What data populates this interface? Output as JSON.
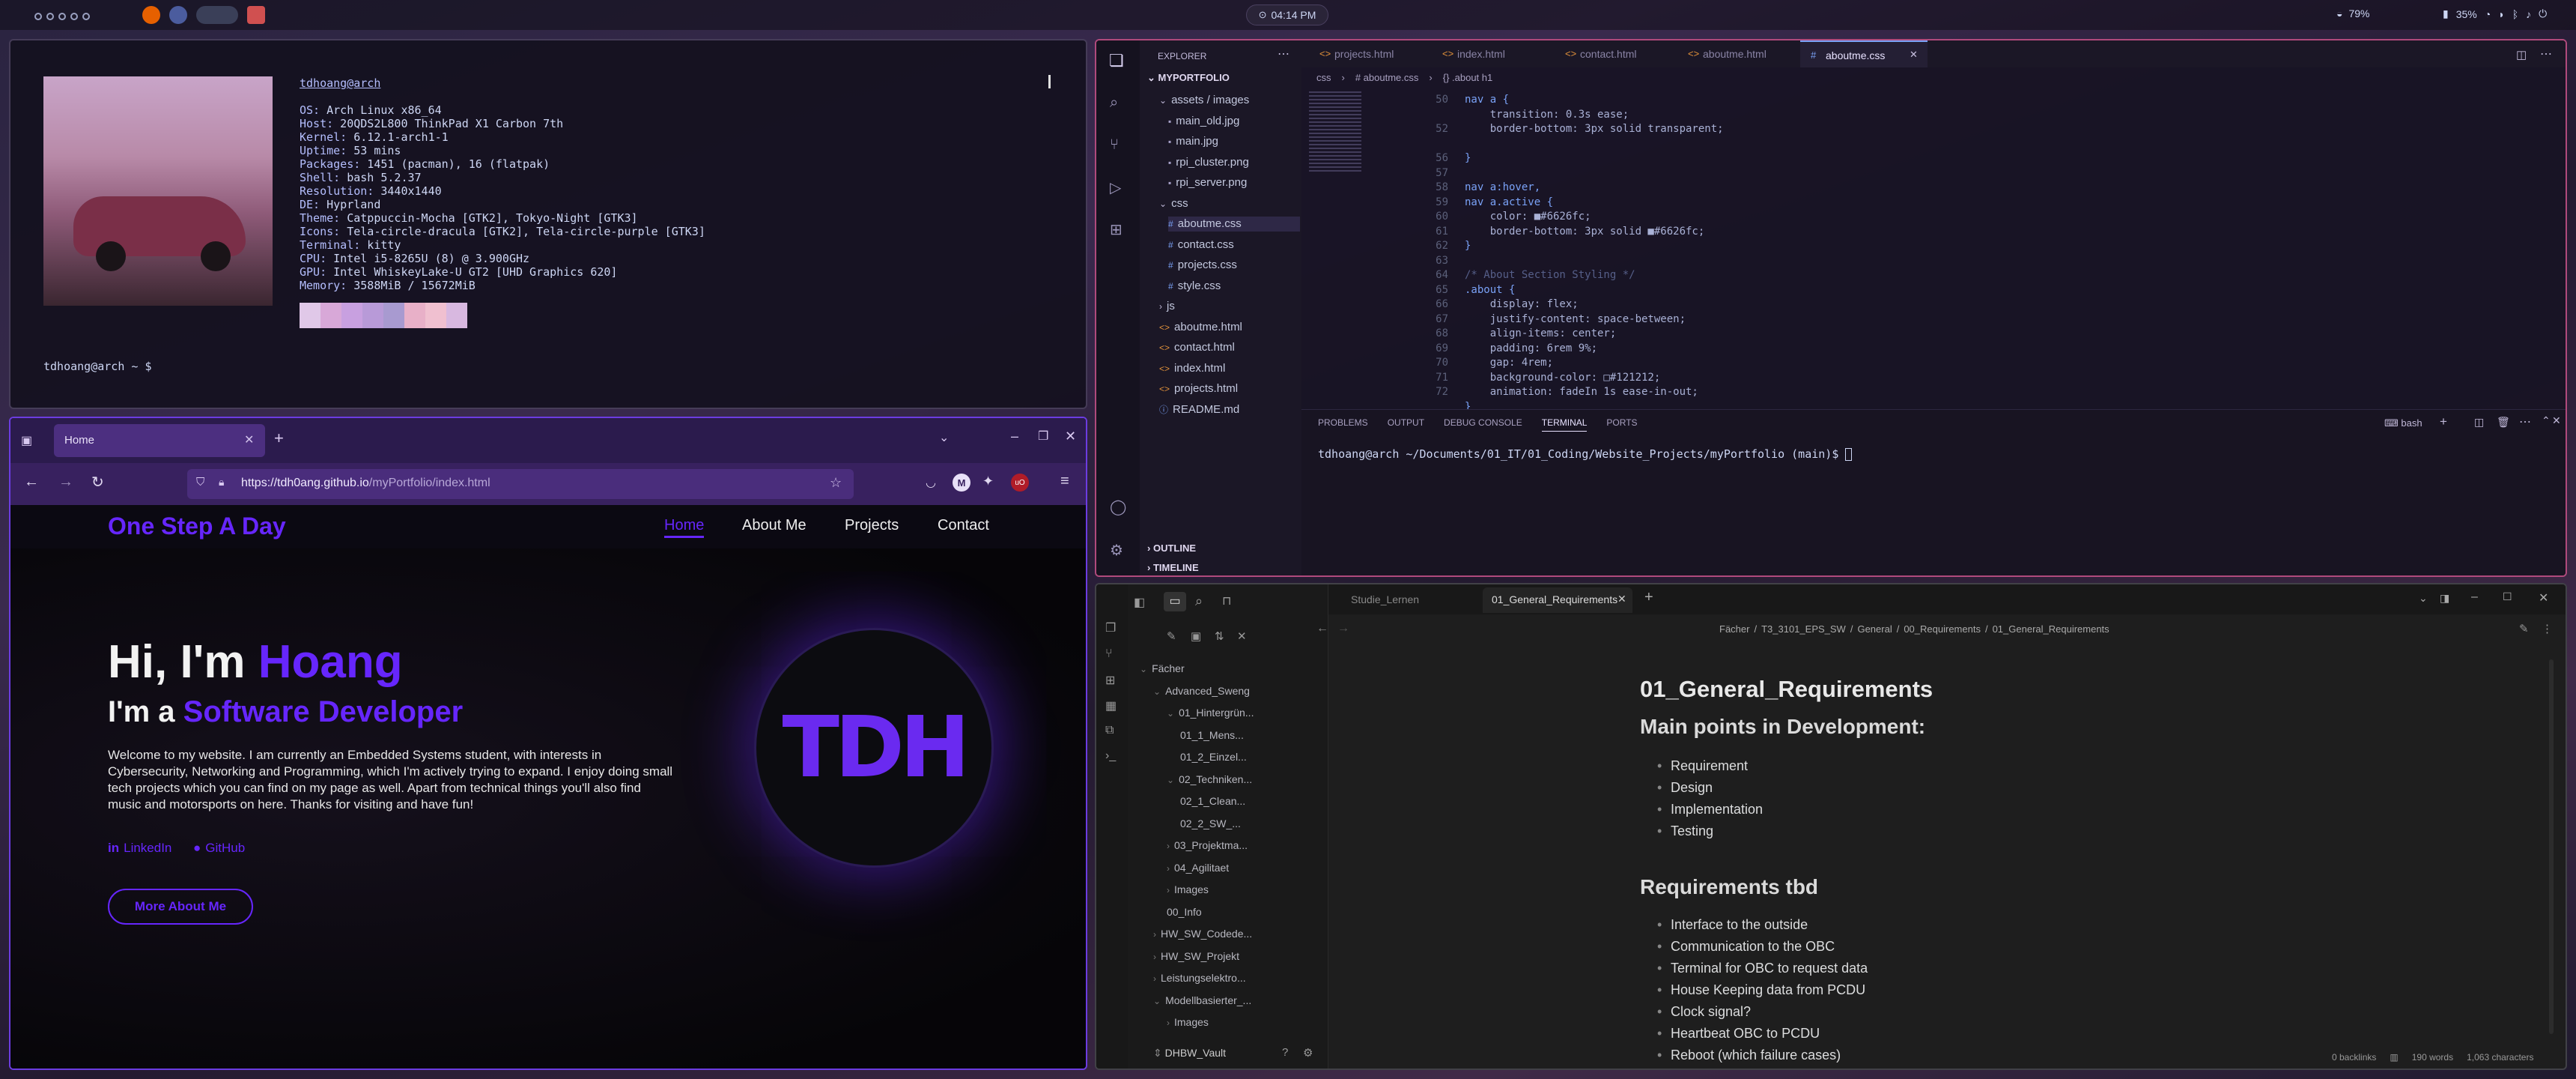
{
  "topbar": {
    "clock": "04:14 PM",
    "wifi_percent": "79%",
    "battery_percent": "35%"
  },
  "terminal": {
    "user_host": "tdhoang@arch",
    "info": [
      {
        "k": "OS:",
        "v": " Arch Linux x86_64"
      },
      {
        "k": "Host:",
        "v": " 20QDS2L800 ThinkPad X1 Carbon 7th"
      },
      {
        "k": "Kernel:",
        "v": " 6.12.1-arch1-1"
      },
      {
        "k": "Uptime:",
        "v": " 53 mins"
      },
      {
        "k": "Packages:",
        "v": " 1451 (pacman), 16 (flatpak)"
      },
      {
        "k": "Shell:",
        "v": " bash 5.2.37"
      },
      {
        "k": "Resolution:",
        "v": " 3440x1440"
      },
      {
        "k": "DE:",
        "v": " Hyprland"
      },
      {
        "k": "Theme:",
        "v": " Catppuccin-Mocha [GTK2], Tokyo-Night [GTK3]"
      },
      {
        "k": "Icons:",
        "v": " Tela-circle-dracula [GTK2], Tela-circle-purple [GTK3]"
      },
      {
        "k": "Terminal:",
        "v": " kitty"
      },
      {
        "k": "CPU:",
        "v": " Intel i5-8265U (8) @ 3.900GHz"
      },
      {
        "k": "GPU:",
        "v": " Intel WhiskeyLake-U GT2 [UHD Graphics 620]"
      },
      {
        "k": "Memory:",
        "v": " 3588MiB / 15672MiB"
      }
    ],
    "prompt": "tdhoang@arch ~ $",
    "palette": [
      "#e0c8e8",
      "#d8a8d8",
      "#c8a0e0",
      "#b89ad8",
      "#a89ad0",
      "#e8b0c8",
      "#f0c0d0",
      "#d8b8e0"
    ]
  },
  "firefox": {
    "tab_title": "Home",
    "url_domain": "https://tdh0ang.github.io",
    "url_path": "/myPortfolio/index.html",
    "site": {
      "brand": "One Step A Day",
      "nav": [
        "Home",
        "About Me",
        "Projects",
        "Contact"
      ],
      "hi_prefix": "Hi, I'm ",
      "hi_name": "Hoang",
      "role_prefix": "I'm a ",
      "role": "Software Developer",
      "intro": "Welcome to my website. I am currently an Embedded Systems student, with interests in Cybersecurity, Networking and Programming, which I'm actively trying to expand. I enjoy doing small tech projects which you can find on my page as well. Apart from technical things you'll also find music and motorsports on here. Thanks for visiting and have fun!",
      "linkedin": "LinkedIn",
      "github": "GitHub",
      "cta": "More About Me",
      "logo": "TDH"
    }
  },
  "vscode": {
    "tabs": [
      {
        "label": "projects.html",
        "active": false
      },
      {
        "label": "index.html",
        "active": false
      },
      {
        "label": "contact.html",
        "active": false
      },
      {
        "label": "aboutme.html",
        "active": false
      },
      {
        "label": "aboutme.css",
        "active": true
      }
    ],
    "explorer_title": "EXPLORER",
    "project": "MYPORTFOLIO",
    "tree": [
      {
        "label": "assets / images",
        "indent": 1,
        "type": "folder"
      },
      {
        "label": "main_old.jpg",
        "indent": 2,
        "type": "img"
      },
      {
        "label": "main.jpg",
        "indent": 2,
        "type": "img"
      },
      {
        "label": "rpi_cluster.png",
        "indent": 2,
        "type": "img"
      },
      {
        "label": "rpi_server.png",
        "indent": 2,
        "type": "img"
      },
      {
        "label": "css",
        "indent": 1,
        "type": "folder"
      },
      {
        "label": "aboutme.css",
        "indent": 2,
        "type": "css"
      },
      {
        "label": "contact.css",
        "indent": 2,
        "type": "css"
      },
      {
        "label": "projects.css",
        "indent": 2,
        "type": "css"
      },
      {
        "label": "style.css",
        "indent": 2,
        "type": "css"
      },
      {
        "label": "js",
        "indent": 1,
        "type": "folder"
      },
      {
        "label": "aboutme.html",
        "indent": 1,
        "type": "html"
      },
      {
        "label": "contact.html",
        "indent": 1,
        "type": "html"
      },
      {
        "label": "index.html",
        "indent": 1,
        "type": "html"
      },
      {
        "label": "projects.html",
        "indent": 1,
        "type": "html"
      },
      {
        "label": "README.md",
        "indent": 1,
        "type": "md"
      }
    ],
    "breadcrumb": [
      "css",
      "# aboutme.css",
      "{} .about h1"
    ],
    "code": [
      {
        "n": "50",
        "t": "nav a {"
      },
      {
        "n": "",
        "t": "    transition: 0.3s ease;"
      },
      {
        "n": "52",
        "t": "    border-bottom: 3px solid transparent;"
      },
      {
        "n": "",
        "t": ""
      },
      {
        "n": "56",
        "t": "}"
      },
      {
        "n": "57",
        "t": ""
      },
      {
        "n": "58",
        "t": "nav a:hover,"
      },
      {
        "n": "59",
        "t": "nav a.active {"
      },
      {
        "n": "60",
        "t": "    color: ■#6626fc;"
      },
      {
        "n": "61",
        "t": "    border-bottom: 3px solid ■#6626fc;"
      },
      {
        "n": "62",
        "t": "}"
      },
      {
        "n": "63",
        "t": ""
      },
      {
        "n": "64",
        "t": "/* About Section Styling */"
      },
      {
        "n": "65",
        "t": ".about {"
      },
      {
        "n": "66",
        "t": "    display: flex;"
      },
      {
        "n": "67",
        "t": "    justify-content: space-between;"
      },
      {
        "n": "68",
        "t": "    align-items: center;"
      },
      {
        "n": "69",
        "t": "    padding: 6rem 9%;"
      },
      {
        "n": "70",
        "t": "    gap: 4rem;"
      },
      {
        "n": "71",
        "t": "    background-color: □#121212;"
      },
      {
        "n": "72",
        "t": "    animation: fadeIn 1s ease-in-out;"
      },
      {
        "n": "",
        "t": "}"
      }
    ],
    "panel_tabs": [
      "PROBLEMS",
      "OUTPUT",
      "DEBUG CONSOLE",
      "TERMINAL",
      "PORTS"
    ],
    "panel_shell": "bash",
    "terminal_line": "tdhoang@arch ~/Documents/01_IT/01_Coding/Website_Projects/myPortfolio (main)$ ",
    "outline": "OUTLINE",
    "timeline": "TIMELINE"
  },
  "obsidian": {
    "tabs": [
      "Studie_Lernen",
      "01_General_Requirements"
    ],
    "breadcrumb": [
      "Fächer",
      "T3_3101_EPS_SW",
      "General",
      "00_Requirements",
      "01_General_Requirements"
    ],
    "tree": [
      {
        "label": "Fächer",
        "indent": 0
      },
      {
        "label": "Advanced_Sweng",
        "indent": 1
      },
      {
        "label": "01_Hintergrün...",
        "indent": 2
      },
      {
        "label": "01_1_Mens...",
        "indent": 3
      },
      {
        "label": "01_2_Einzel...",
        "indent": 3
      },
      {
        "label": "02_Techniken...",
        "indent": 2
      },
      {
        "label": "02_1_Clean...",
        "indent": 3
      },
      {
        "label": "02_2_SW_...",
        "indent": 3
      },
      {
        "label": "03_Projektma...",
        "indent": 2
      },
      {
        "label": "04_Agilitaet",
        "indent": 2
      },
      {
        "label": "Images",
        "indent": 2
      },
      {
        "label": "00_Info",
        "indent": 2
      },
      {
        "label": "HW_SW_Codede...",
        "indent": 1
      },
      {
        "label": "HW_SW_Projekt",
        "indent": 1
      },
      {
        "label": "Leistungselektro...",
        "indent": 1
      },
      {
        "label": "Modellbasierter_...",
        "indent": 1
      },
      {
        "label": "Images",
        "indent": 2
      }
    ],
    "vault": "DHBW_Vault",
    "note": {
      "title": "01_General_Requirements",
      "h2a": "Main points in Development:",
      "listA": [
        "Requirement",
        "Design",
        "Implementation",
        "Testing"
      ],
      "h2b": "Requirements tbd",
      "listB": [
        "Interface to the outside",
        "Communication to the OBC",
        "Terminal for OBC to request data",
        "House Keeping data from PCDU",
        "Clock signal?",
        "Heartbeat OBC to PCDU",
        "Reboot (which failure cases)"
      ]
    },
    "status": {
      "backlinks": "0 backlinks",
      "words": "190 words",
      "chars": "1,063 characters"
    }
  }
}
